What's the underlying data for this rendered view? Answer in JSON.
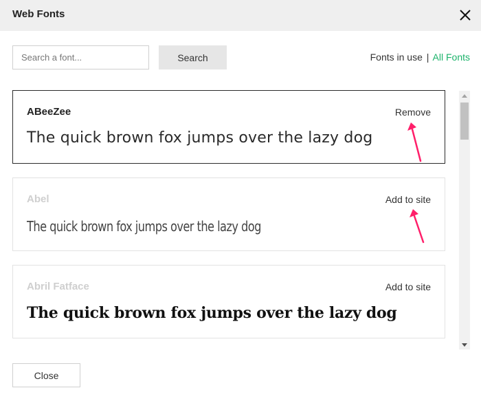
{
  "dialog": {
    "title": "Web Fonts"
  },
  "search": {
    "placeholder": "Search a font...",
    "value": "",
    "button_label": "Search"
  },
  "filters": {
    "fonts_in_use": "Fonts in use",
    "separator": "|",
    "all_fonts": "All Fonts"
  },
  "fonts": [
    {
      "name": "ABeeZee",
      "action": "Remove",
      "sample": "The quick brown fox jumps over the lazy dog",
      "selected": true
    },
    {
      "name": "Abel",
      "action": "Add to site",
      "sample": "The quick brown fox jumps over the lazy dog",
      "selected": false
    },
    {
      "name": "Abril Fatface",
      "action": "Add to site",
      "sample": "The quick brown fox jumps over the lazy dog",
      "selected": false
    }
  ],
  "footer": {
    "close_label": "Close"
  },
  "colors": {
    "accent": "#1cb36b",
    "annotation_arrow": "#ff1f6a",
    "header_bg": "#efefef"
  },
  "icons": {
    "close": "close-icon",
    "scroll_up": "chevron-up-icon",
    "scroll_down": "chevron-down-icon",
    "annotation": "arrow-annotation-icon"
  }
}
